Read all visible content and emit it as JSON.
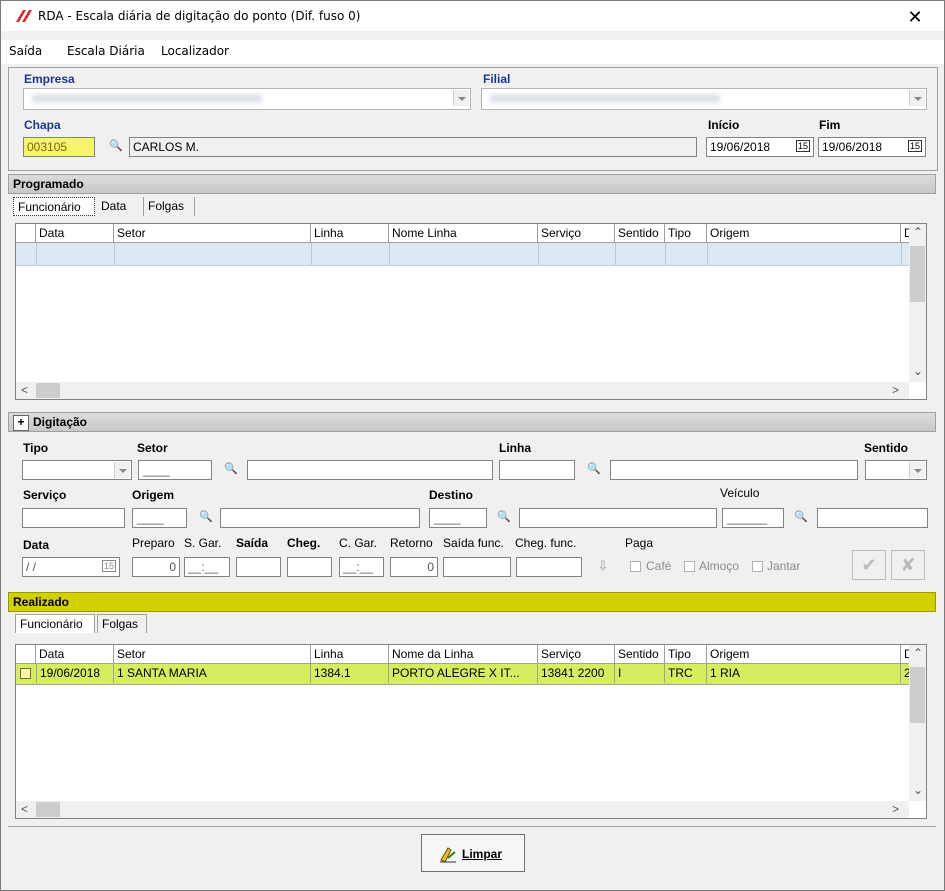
{
  "window": {
    "title": "RDA - Escala diária de digitação do ponto (Dif. fuso 0)",
    "close_glyph": "✕"
  },
  "menu": [
    "Saída",
    "Escala Diária",
    "Localizador"
  ],
  "header": {
    "empresa_label": "Empresa",
    "filial_label": "Filial",
    "chapa_label": "Chapa",
    "chapa_value": "003105",
    "chapa_name": "CARLOS M.",
    "inicio_label": "Início",
    "fim_label": "Fim",
    "inicio_value": "19/06/2018",
    "fim_value": "19/06/2018",
    "calendar_glyph": "15"
  },
  "programado": {
    "title": "Programado",
    "tabs": [
      "Funcionário",
      "Data",
      "Folgas"
    ],
    "columns": [
      "Data",
      "Setor",
      "Linha",
      "Nome Linha",
      "Serviço",
      "Sentido",
      "Tipo",
      "Origem",
      "D"
    ]
  },
  "digitacao": {
    "toggle": "+",
    "title": "Digitação",
    "tipo_label": "Tipo",
    "setor_label": "Setor",
    "linha_label": "Linha",
    "sentido_label": "Sentido",
    "servico_label": "Serviço",
    "origem_label": "Origem",
    "destino_label": "Destino",
    "veiculo_label": "Veículo",
    "data_label": "Data",
    "data_value": " / /",
    "preparo_label": "Preparo",
    "preparo_value": "0",
    "sgar_label": "S. Gar.",
    "saida_label": "Saída",
    "cheg_label": "Cheg.",
    "cgar_label": "C. Gar.",
    "retorno_label": "Retorno",
    "retorno_value": "0",
    "saida_func_label": "Saída func.",
    "cheg_func_label": "Cheg. func.",
    "paga_label": "Paga",
    "cafe_label": "Café",
    "almoco_label": "Almoço",
    "jantar_label": "Jantar",
    "time_mask": "__:__"
  },
  "realizado": {
    "title": "Realizado",
    "tabs": [
      "Funcionário",
      "Folgas"
    ],
    "columns": [
      "Data",
      "Setor",
      "Linha",
      "Nome da Linha",
      "Serviço",
      "Sentido",
      "Tipo",
      "Origem",
      "D"
    ],
    "rows": [
      {
        "data": "19/06/2018",
        "setor": "1 SANTA MARIA",
        "linha": "1384.1",
        "nome": "PORTO ALEGRE X IT...",
        "servico": "13841 2200",
        "sentido": "I",
        "tipo": "TRC",
        "origem": "1 RIA",
        "d": "2"
      }
    ]
  },
  "footer": {
    "limpar_label": "Limpar"
  },
  "colors": {
    "highlight_yellow": "#f5f56a",
    "section_yellow": "#d2d000",
    "row_blue": "#dce8f4"
  }
}
